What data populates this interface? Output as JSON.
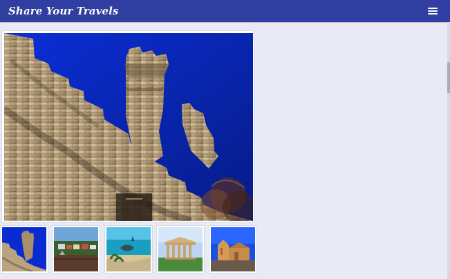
{
  "header": {
    "brand": "Share Your Travels",
    "menu_icon": "hamburger-menu-icon"
  },
  "gallery": {
    "main_image": "castle-wall-photo",
    "thumbnails": [
      "castle-thumb",
      "harbor-thumb",
      "shipwreck-beach-thumb",
      "greek-temple-thumb",
      "cathedral-thumb"
    ]
  },
  "colors": {
    "header_bg": "#2f3ea0",
    "page_bg": "#e8eaf6",
    "card_bg": "#ffffff"
  }
}
